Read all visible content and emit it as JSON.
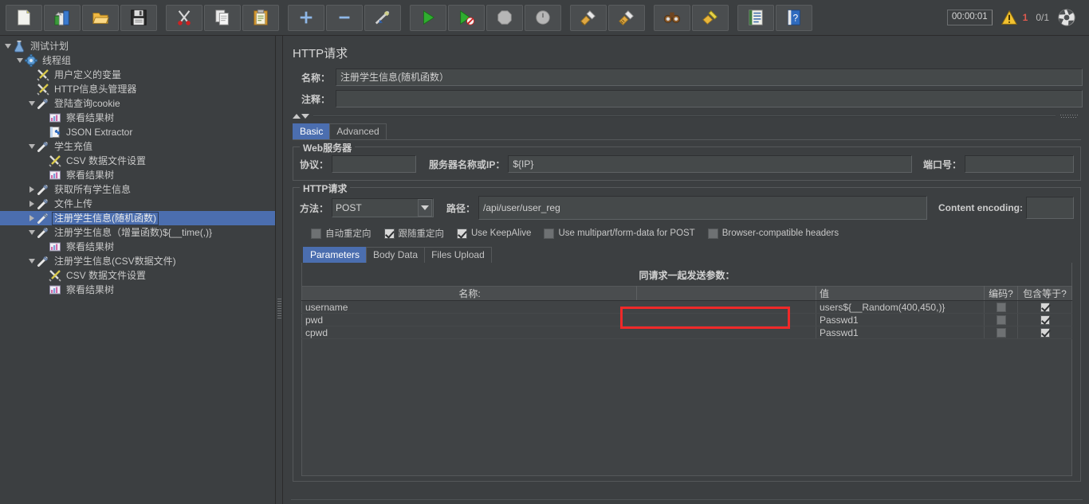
{
  "toolbar": {
    "buttons": [
      {
        "name": "new-button",
        "icon": "new-document-icon",
        "tooltip": "New"
      },
      {
        "name": "templates-button",
        "icon": "templates-icon",
        "tooltip": "Templates"
      },
      {
        "name": "open-button",
        "icon": "open-folder-icon",
        "tooltip": "Open"
      },
      {
        "name": "save-button",
        "icon": "save-floppy-icon",
        "tooltip": "Save"
      },
      {
        "name": "cut-button",
        "icon": "scissors-icon",
        "tooltip": "Cut"
      },
      {
        "name": "copy-button",
        "icon": "copy-pages-icon",
        "tooltip": "Copy"
      },
      {
        "name": "paste-button",
        "icon": "clipboard-paste-icon",
        "tooltip": "Paste"
      },
      {
        "name": "expand-all-button",
        "icon": "plus-icon",
        "tooltip": "Expand All"
      },
      {
        "name": "collapse-all-button",
        "icon": "minus-icon",
        "tooltip": "Collapse All"
      },
      {
        "name": "toggle-button",
        "icon": "toggle-pencil-icon",
        "tooltip": "Toggle"
      },
      {
        "name": "start-button",
        "icon": "green-play-icon",
        "tooltip": "Start"
      },
      {
        "name": "start-no-pauses-button",
        "icon": "green-play-no-timers-icon",
        "tooltip": "Start no pauses"
      },
      {
        "name": "stop-button",
        "icon": "stop-octagon-icon",
        "tooltip": "Stop"
      },
      {
        "name": "shutdown-button",
        "icon": "shutdown-circle-icon",
        "tooltip": "Shutdown"
      },
      {
        "name": "clear-button",
        "icon": "clear-broom-icon",
        "tooltip": "Clear"
      },
      {
        "name": "clear-all-button",
        "icon": "clear-all-broom-icon",
        "tooltip": "Clear All"
      },
      {
        "name": "search-button",
        "icon": "binoculars-icon",
        "tooltip": "Search"
      },
      {
        "name": "reset-search-button",
        "icon": "reset-search-broom-icon",
        "tooltip": "Reset Search"
      },
      {
        "name": "function-helper-button",
        "icon": "function-helper-icon",
        "tooltip": "Function Helper Dialog"
      },
      {
        "name": "help-button",
        "icon": "help-book-icon",
        "tooltip": "Help"
      }
    ],
    "timer": "00:00:01",
    "warning_icon": "warning-triangle-icon",
    "warning_count": "1",
    "thread_count": "0/1",
    "settings_icon": "globe-settings-icon"
  },
  "tree": {
    "nodes": [
      {
        "label": "测试计划",
        "depth": 0,
        "toggle": "open",
        "icon": "test-plan-icon",
        "selected": false
      },
      {
        "label": "线程组",
        "depth": 1,
        "toggle": "open",
        "icon": "thread-group-icon",
        "selected": false
      },
      {
        "label": "用户定义的变量",
        "depth": 2,
        "toggle": "none",
        "icon": "config-element-icon",
        "selected": false
      },
      {
        "label": "HTTP信息头管理器",
        "depth": 2,
        "toggle": "none",
        "icon": "config-element-icon",
        "selected": false
      },
      {
        "label": "登陆查询cookie",
        "depth": 2,
        "toggle": "open",
        "icon": "http-sampler-icon",
        "selected": false
      },
      {
        "label": "察看结果树",
        "depth": 3,
        "toggle": "none",
        "icon": "view-results-tree-icon",
        "selected": false
      },
      {
        "label": "JSON Extractor",
        "depth": 3,
        "toggle": "none",
        "icon": "json-extractor-icon",
        "selected": false
      },
      {
        "label": "学生充值",
        "depth": 2,
        "toggle": "open",
        "icon": "http-sampler-icon",
        "selected": false
      },
      {
        "label": "CSV 数据文件设置",
        "depth": 3,
        "toggle": "none",
        "icon": "config-element-icon",
        "selected": false
      },
      {
        "label": "察看结果树",
        "depth": 3,
        "toggle": "none",
        "icon": "view-results-tree-icon",
        "selected": false
      },
      {
        "label": "获取所有学生信息",
        "depth": 2,
        "toggle": "closed",
        "icon": "http-sampler-icon",
        "selected": false
      },
      {
        "label": "文件上传",
        "depth": 2,
        "toggle": "closed",
        "icon": "http-sampler-icon",
        "selected": false
      },
      {
        "label": "注册学生信息(随机函数)",
        "depth": 2,
        "toggle": "closed",
        "icon": "http-sampler-icon",
        "selected": true
      },
      {
        "label": "注册学生信息（增量函数)${__time(,)}",
        "depth": 2,
        "toggle": "open",
        "icon": "http-sampler-icon",
        "selected": false
      },
      {
        "label": "察看结果树",
        "depth": 3,
        "toggle": "none",
        "icon": "view-results-tree-icon",
        "selected": false
      },
      {
        "label": "注册学生信息(CSV数据文件)",
        "depth": 2,
        "toggle": "open",
        "icon": "http-sampler-icon",
        "selected": false
      },
      {
        "label": "CSV 数据文件设置",
        "depth": 3,
        "toggle": "none",
        "icon": "config-element-icon",
        "selected": false
      },
      {
        "label": "察看结果树",
        "depth": 3,
        "toggle": "none",
        "icon": "view-results-tree-icon",
        "selected": false
      }
    ]
  },
  "panel": {
    "title": "HTTP请求",
    "name_label": "名称：",
    "name_value": "注册学生信息(随机函数）",
    "comment_label": "注释：",
    "comment_value": "",
    "tabs": [
      {
        "label": "Basic",
        "active": true
      },
      {
        "label": "Advanced",
        "active": false
      }
    ],
    "web_server": {
      "title": "Web服务器",
      "protocol_label": "协议：",
      "protocol_value": "",
      "server_label": "服务器名称或IP：",
      "server_value": "${IP}",
      "port_label": "端口号：",
      "port_value": ""
    },
    "http_request": {
      "title": "HTTP请求",
      "method_label": "方法：",
      "method_value": "POST",
      "path_label": "路径：",
      "path_value": "/api/user/user_reg",
      "content_encoding_label": "Content encoding:",
      "content_encoding_value": "",
      "checkboxes": [
        {
          "label": "自动重定向",
          "checked": false
        },
        {
          "label": "跟随重定向",
          "checked": true
        },
        {
          "label": "Use KeepAlive",
          "checked": true
        },
        {
          "label": "Use multipart/form-data for POST",
          "checked": false
        },
        {
          "label": "Browser-compatible headers",
          "checked": false
        }
      ],
      "param_tabs": [
        {
          "label": "Parameters",
          "active": true
        },
        {
          "label": "Body Data",
          "active": false
        },
        {
          "label": "Files Upload",
          "active": false
        }
      ],
      "send_params_label": "同请求一起发送参数：",
      "table": {
        "headers": [
          "名称:",
          "值",
          "编码?",
          "包含等于?"
        ],
        "rows": [
          {
            "name": "username",
            "value": "users${__Random(400,450,)}",
            "encode": false,
            "include_equals": true
          },
          {
            "name": "pwd",
            "value": "Passwd1",
            "encode": false,
            "include_equals": true
          },
          {
            "name": "cpwd",
            "value": "Passwd1",
            "encode": false,
            "include_equals": true
          }
        ]
      }
    }
  },
  "annotation": {
    "highlight_color": "#ef2929",
    "target": "username-value-cell"
  }
}
